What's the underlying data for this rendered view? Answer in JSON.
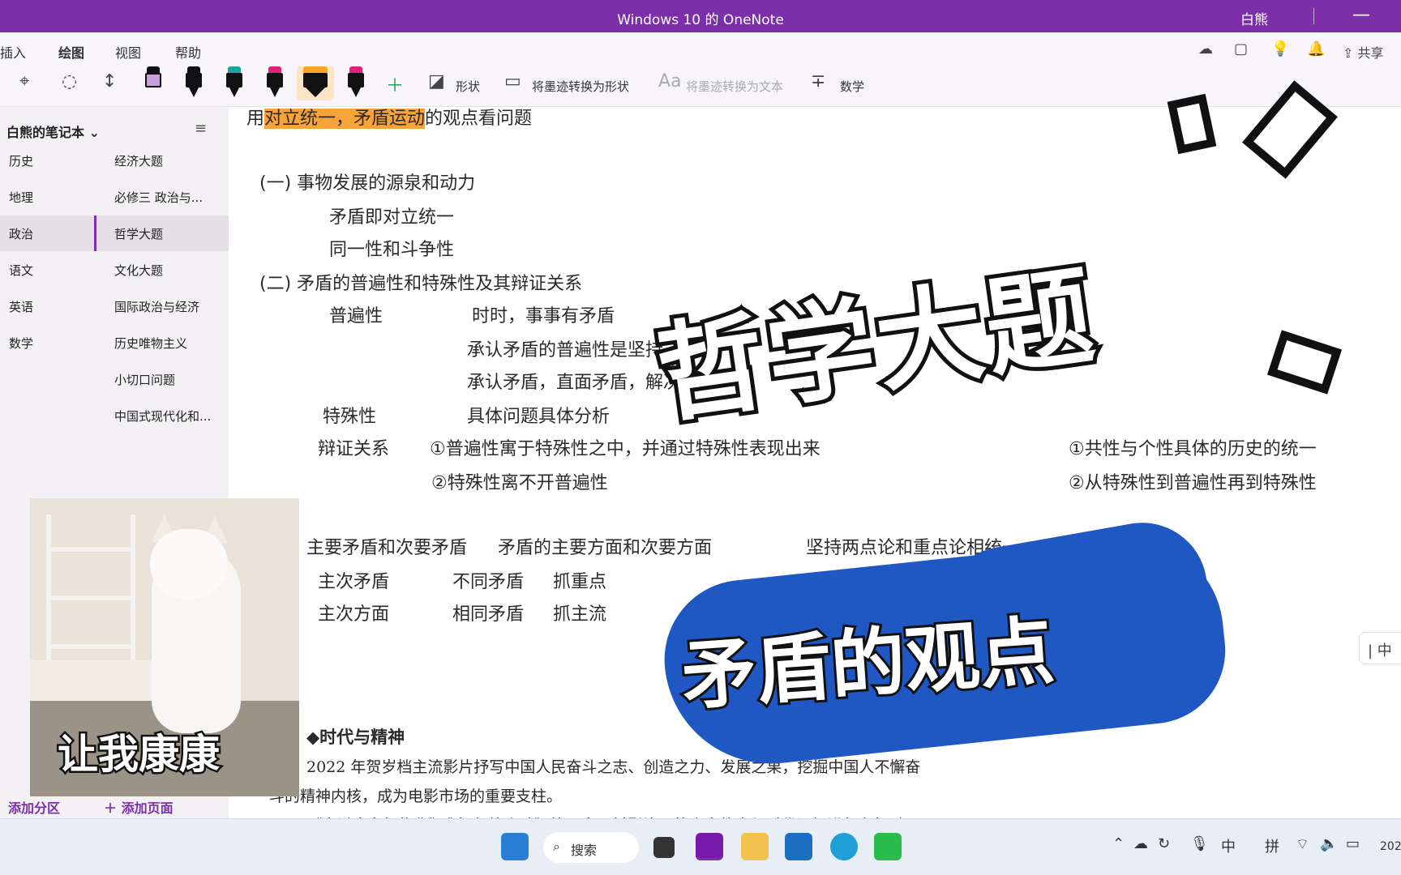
{
  "window": {
    "title": "Windows 10 的 OneNote",
    "user": "白熊",
    "minimize_glyph": "—"
  },
  "tabs": [
    {
      "label": "插入"
    },
    {
      "label": "绘图",
      "active": true
    },
    {
      "label": "视图"
    },
    {
      "label": "帮助"
    }
  ],
  "top_right": {
    "share_label": "共享",
    "icons": [
      "sync-icon",
      "notebook-icon",
      "lightbulb-icon",
      "bell-icon",
      "share-icon"
    ]
  },
  "toolbar": {
    "shapes_label": "形状",
    "ink_to_shape_label": "将墨迹转换为形状",
    "ink_to_text_label": "将墨迹转换为文本",
    "math_label": "数学",
    "pen_colors": [
      "#c9a0dc",
      "#111111",
      "#1aa39a",
      "#e0207a",
      "#f6a623",
      "#e0207a"
    ]
  },
  "notebook": {
    "name": "白熊的笔记本"
  },
  "sections": [
    "历史",
    "地理",
    "政治",
    "语文",
    "英语",
    "数学"
  ],
  "selected_section": "政治",
  "pages": [
    "经济大题",
    "必修三 政治与...",
    "哲学大题",
    "文化大题",
    "国际政治与经济",
    "历史唯物主义",
    "小切口问题",
    "中国式现代化和..."
  ],
  "selected_page": "哲学大题",
  "sidebar_footer": {
    "add_section": "添加分区",
    "add_page": "添加页面"
  },
  "note": {
    "line0_prefix": "用",
    "line0_highlight": "对立统一，矛盾运动",
    "line0_suffix": "的观点看问题",
    "l1": "(一) 事物发展的源泉和动力",
    "l2": "矛盾即对立统一",
    "l3": "同一性和斗争性",
    "l4": "(二) 矛盾的普遍性和特殊性及其辩证关系",
    "l5a": "普遍性",
    "l5b": "时时，事事有矛盾",
    "l6": "承认矛盾的普遍性是坚持",
    "l7": "承认矛盾，直面矛盾，解决",
    "l8a": "特殊性",
    "l8b": "具体问题具体分析",
    "l9a": "辩证关系",
    "l9b": "①普遍性寓于特殊性之中，并通过特殊性表现出来",
    "l9c": "①共性与个性具体的历史的统一",
    "l10b": "②特殊性离不开普遍性",
    "l10c": "②从特殊性到普遍性再到特殊性",
    "l11a": "主要矛盾和次要矛盾",
    "l11b": "矛盾的主要方面和次要方面",
    "l11c": "坚持两点论和重点论相统一",
    "l12a": "主次矛盾",
    "l12b": "不同矛盾",
    "l12c": "抓重点",
    "l13a": "主次方面",
    "l13b": "相同矛盾",
    "l13c": "抓主流",
    "era_title": "◆时代与精神",
    "era_p1": "2022 年贺岁档主流影片抒写中国人民奋斗之志、创造之力、发展之果，挖掘中国人不懈奋",
    "era_p2": "斗的精神内核，成为电影市场的重要支柱。",
    "era_p3": "《穿过寒冬拥抱你》《奇迹·笨小孩》等现实题材影片，将个人故事与时代记忆进行有机融"
  },
  "overlay": {
    "title": "哲学大题",
    "subtitle": "矛盾的观点",
    "cat_caption": "让我康康",
    "accent_blue": "#1f57c3"
  },
  "side_handle": {
    "label": "| 中"
  },
  "taskbar": {
    "search_label": "搜索",
    "tray_ime_1": "中",
    "tray_ime_2": "拼",
    "clock_partial": "202"
  },
  "colors": {
    "title_bar": "#7b2fa8",
    "highlight": "#f8a33a"
  }
}
